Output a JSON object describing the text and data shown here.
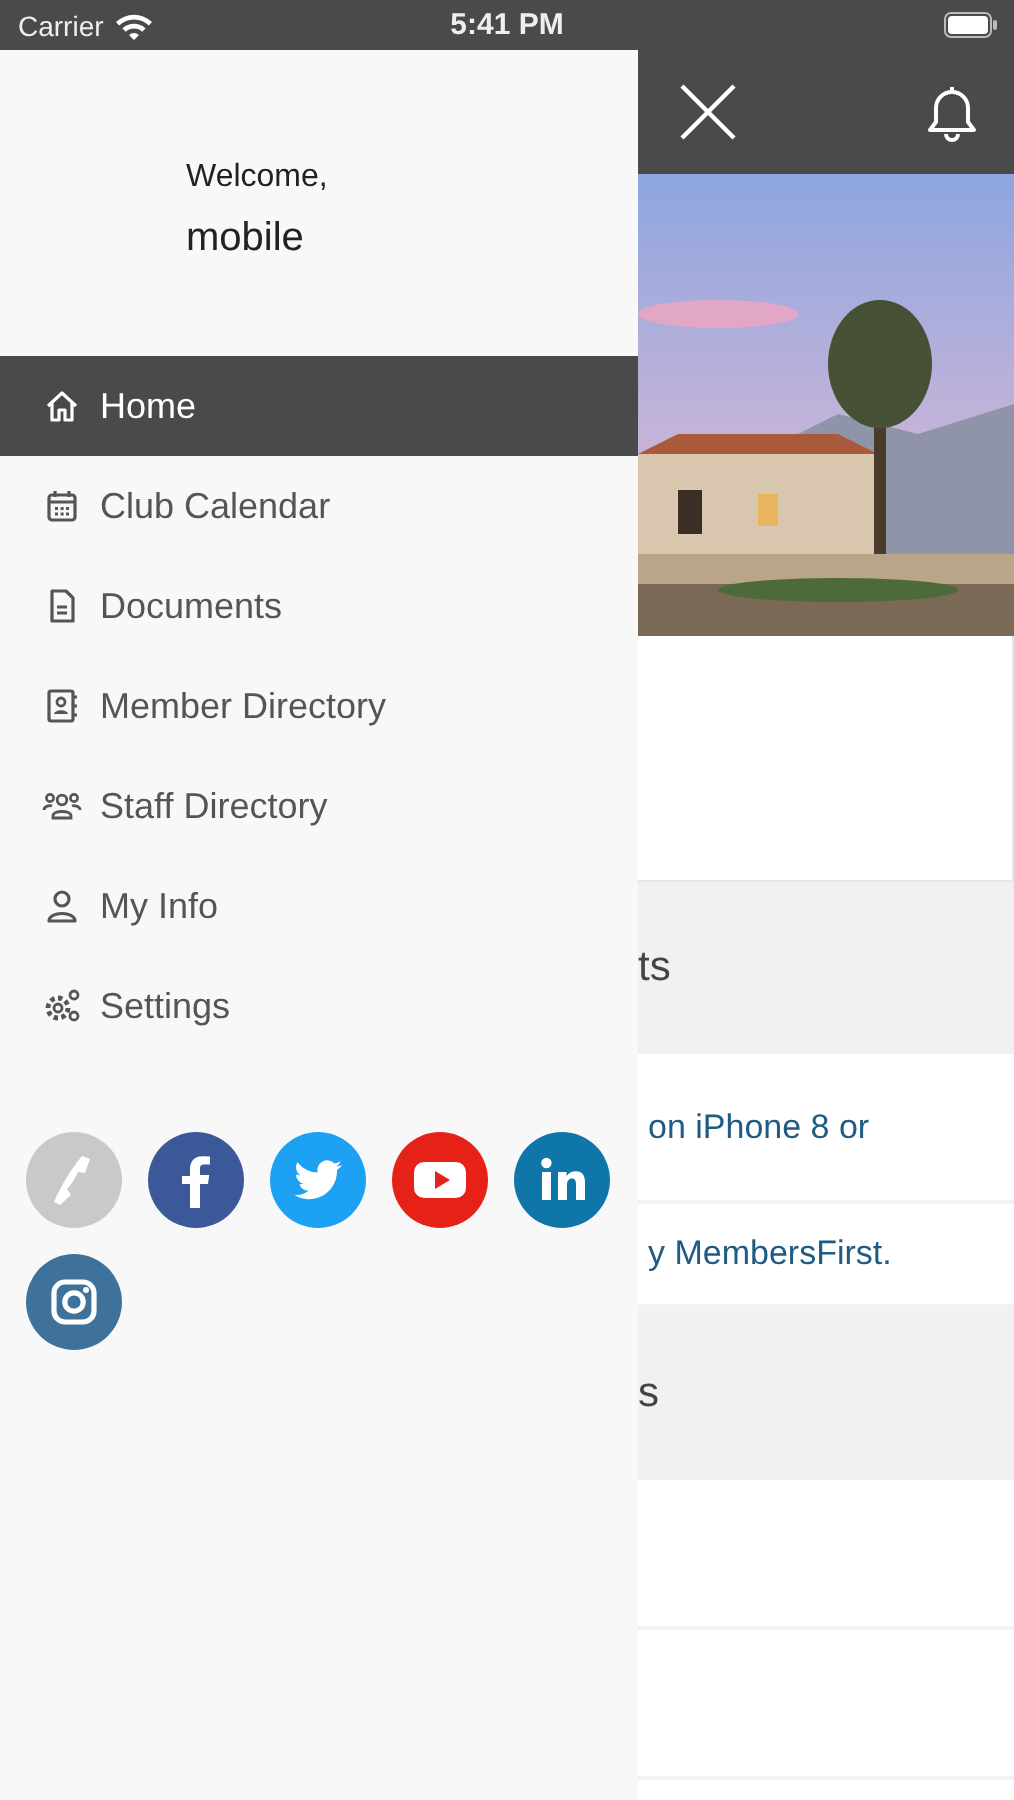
{
  "status_bar": {
    "carrier": "Carrier",
    "time": "5:41 PM"
  },
  "drawer": {
    "greeting": "Welcome,",
    "username": "mobile",
    "menu": [
      {
        "label": "Home",
        "kind": "home",
        "selected": true
      },
      {
        "label": "Club Calendar",
        "kind": "calendar",
        "selected": false
      },
      {
        "label": "Documents",
        "kind": "document",
        "selected": false
      },
      {
        "label": "Member Directory",
        "kind": "contact",
        "selected": false
      },
      {
        "label": "Staff Directory",
        "kind": "group",
        "selected": false
      },
      {
        "label": "My Info",
        "kind": "person",
        "selected": false
      },
      {
        "label": "Settings",
        "kind": "gears",
        "selected": false
      }
    ],
    "social": [
      {
        "kind": "phone"
      },
      {
        "kind": "facebook"
      },
      {
        "kind": "twitter"
      },
      {
        "kind": "youtube"
      },
      {
        "kind": "linkedin"
      },
      {
        "kind": "instagram"
      }
    ]
  },
  "main": {
    "sections": [
      {
        "kind": "header",
        "text": "ts"
      },
      {
        "kind": "link",
        "text": "on iPhone 8 or"
      },
      {
        "kind": "link",
        "text": "y MembersFirst."
      },
      {
        "kind": "header",
        "text": "s"
      },
      {
        "kind": "blank"
      },
      {
        "kind": "blank"
      }
    ]
  }
}
